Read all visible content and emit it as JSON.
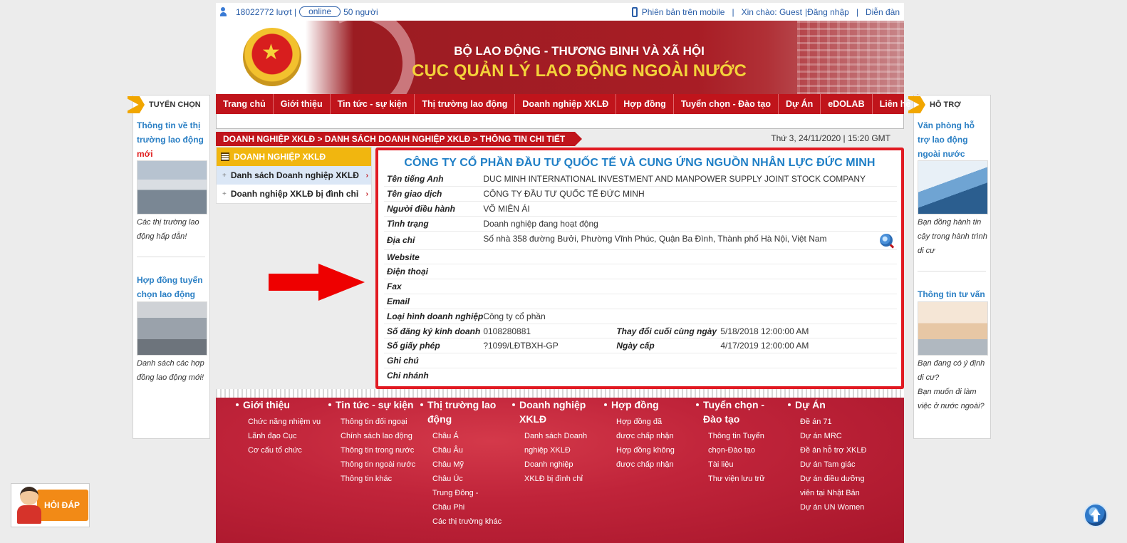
{
  "topbar": {
    "visits": "18022772 lượt |",
    "online_label": "online",
    "online_count": "50 người",
    "mobile_label": "Phiên bản trên mobile",
    "sep1": "|",
    "greeting": "Xin chào: Guest",
    "login": "|Đăng nhập",
    "sep2": "|",
    "forum": "Diễn đàn"
  },
  "banner": {
    "ministry": "BỘ LAO ĐỘNG - THƯƠNG BINH VÀ XÃ HỘI",
    "department": "CỤC QUẢN LÝ LAO ĐỘNG NGOÀI NƯỚC"
  },
  "nav": [
    {
      "label": "Trang chủ"
    },
    {
      "label": "Giới thiệu"
    },
    {
      "label": "Tin tức - sự kiện"
    },
    {
      "label": "Thị trường lao động"
    },
    {
      "label": "Doanh nghiệp XKLĐ"
    },
    {
      "label": "Hợp đồng"
    },
    {
      "label": "Tuyển chọn - Đào tạo"
    },
    {
      "label": "Dự Án"
    },
    {
      "label": "eDOLAB"
    },
    {
      "label": "Liên hệ"
    }
  ],
  "breadcrumb": "DOANH NGHIỆP XKLĐ > DANH SÁCH DOANH NGHIỆP XKLĐ > THÔNG TIN CHI TIẾT",
  "datetime": "Thứ 3, 24/11/2020 | 15:20 GMT",
  "left_sidebar": {
    "title": "TUYỂN CHỌN",
    "link1_a": "Thông tin về thị trường lao động",
    "link1_b": "mới",
    "caption1": "Các thị trường lao động hấp dẫn!",
    "link2": "Hợp đồng tuyển chọn lao động",
    "caption2": "Danh sách các hợp đồng lao động mới!"
  },
  "right_sidebar": {
    "title": "HỖ TRỢ",
    "link1": "Văn phòng hỗ trợ lao động ngoài nước",
    "caption1": "Bạn đồng hành tin cậy trong hành trình di cư",
    "link2": "Thông tin tư vấn",
    "caption2a": "Bạn đang có ý định di cư?",
    "caption2b": "Bạn muốn đi làm việc ở nước ngoài?"
  },
  "left_menu": {
    "title": "DOANH NGHIỆP XKLĐ",
    "items": [
      {
        "plus": "+",
        "label": "Danh sách Doanh nghiệp XKLĐ",
        "chev": "›"
      },
      {
        "plus": "+",
        "label": "Doanh nghiệp XKLĐ bị đình chỉ",
        "chev": "›"
      }
    ]
  },
  "company": {
    "name": "CÔNG TY CỔ PHẦN ĐẦU TƯ QUỐC TẾ VÀ CUNG ỨNG NGUỒN NHÂN LỰC ĐỨC MINH",
    "fields": {
      "english_name_label": "Tên tiếng Anh",
      "english_name": "DUC MINH INTERNATIONAL INVESTMENT AND MANPOWER SUPPLY JOINT STOCK COMPANY",
      "trade_name_label": "Tên giao dịch",
      "trade_name": "CÔNG TY ĐẦU TƯ QUỐC TẾ ĐỨC MINH",
      "director_label": "Người điều hành",
      "director": "VÕ MIÊN ÁI",
      "status_label": "Tình trạng",
      "status": "Doanh nghiệp đang hoạt động",
      "address_label": "Địa chỉ",
      "address": "Số nhà 358 đường Bưởi, Phường Vĩnh Phúc, Quận Ba Đình, Thành phố Hà Nội, Việt Nam",
      "website_label": "Website",
      "phone_label": "Điện thoại",
      "fax_label": "Fax",
      "email_label": "Email",
      "type_label": "Loại hình doanh nghiệp",
      "type": "Công ty cổ phần",
      "reg_no_label": "Số đăng ký kinh doanh",
      "reg_no": "0108280881",
      "last_change_label": "Thay đổi cuối cùng ngày",
      "last_change": "5/18/2018 12:00:00 AM",
      "license_label": "Số giấy phép",
      "license": "?1099/LĐTBXH-GP",
      "issue_date_label": "Ngày cấp",
      "issue_date": "4/17/2019 12:00:00 AM",
      "note_label": "Ghi chú",
      "branch_label": "Chi nhánh"
    }
  },
  "footer": {
    "columns": [
      {
        "title": "Giới thiệu",
        "links": [
          "Chức năng nhiệm vụ",
          "Lãnh đạo Cục",
          "Cơ cấu tổ chức"
        ]
      },
      {
        "title": "Tin tức - sự kiện",
        "links": [
          "Thông tin đối ngoại",
          "Chính sách lao động",
          "Thông tin trong nước",
          "Thông tin ngoài nước",
          "Thông tin khác"
        ]
      },
      {
        "title": "Thị trường lao động",
        "links": [
          "Châu Á",
          "Châu Âu",
          "Châu Mỹ",
          "Châu Úc",
          "Trung Đông - Châu Phi",
          "Các thị trường khác"
        ]
      },
      {
        "title": "Doanh nghiệp XKLĐ",
        "links": [
          "Danh sách Doanh nghiệp XKLĐ",
          "Doanh nghiệp XKLĐ bị đình chỉ"
        ]
      },
      {
        "title": "Hợp đồng",
        "links": [
          "Hợp đồng đã được chấp nhận",
          "Hợp đồng không được chấp nhận"
        ]
      },
      {
        "title": "Tuyển chọn - Đào tạo",
        "links": [
          "Thông tin Tuyển chọn-Đào tạo",
          "Tài liệu",
          "Thư viện lưu trữ"
        ]
      },
      {
        "title": "Dự Án",
        "links": [
          "Đề án 71",
          "Dự án MRC",
          "Đề án hỗ trợ XKLĐ",
          "Dự án Tam giác",
          "Dự án điều dưỡng viên tại Nhật Bản",
          "Dự án UN Women"
        ]
      }
    ]
  },
  "floating": {
    "hoidap": "HỎI ĐÁP"
  },
  "colors": {
    "primary_red": "#c0141b",
    "highlight_red": "#e11a22",
    "link_blue": "#2a7fc4",
    "title_blue": "#1f7fc6",
    "menu_yellow": "#f1b60f",
    "banner_gold": "#f3d33a"
  }
}
